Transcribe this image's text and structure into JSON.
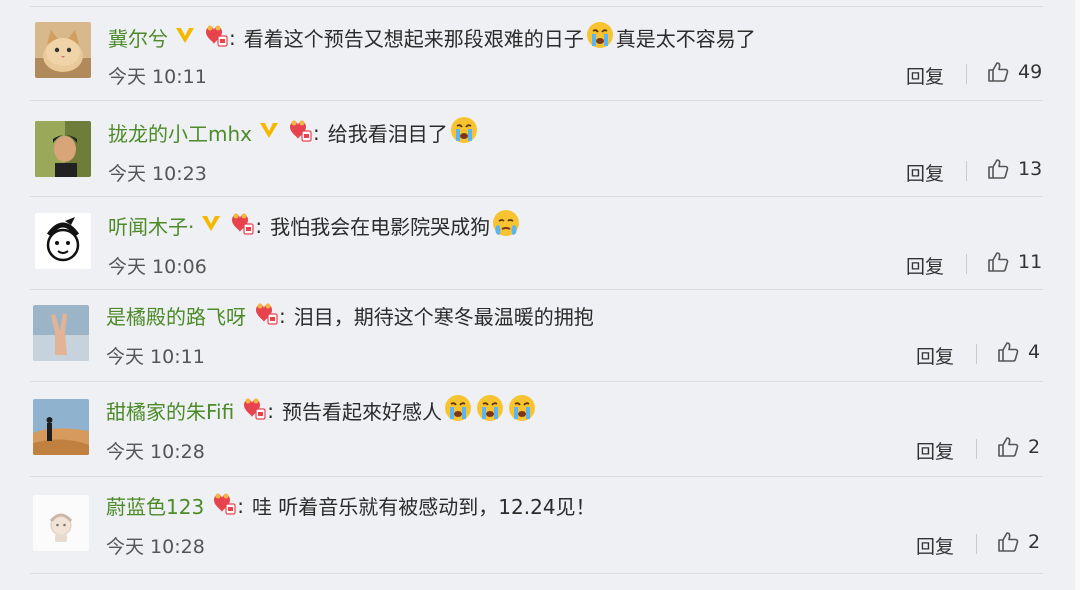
{
  "colors": {
    "username": "#4d8a28",
    "text": "#2b2b2b",
    "background": "#eef0f4"
  },
  "reply_label": "回复",
  "comments": [
    {
      "user": "冀尔兮",
      "verified": true,
      "text_before": "看着这个预告又想起来那段艰难的日子",
      "emojis_mid": [
        "crying-emoji"
      ],
      "text_after": "真是太不容易了",
      "time": "今天 10:11",
      "likes": "49",
      "avatar": "cat-photo-avatar"
    },
    {
      "user": "拢龙的小工mhx",
      "verified": true,
      "text_before": "给我看泪目了",
      "emojis_mid": [
        "crying-emoji"
      ],
      "text_after": "",
      "time": "今天 10:23",
      "likes": "13",
      "avatar": "person-photo-avatar"
    },
    {
      "user": "听闻木子·",
      "verified": true,
      "text_before": "我怕我会在电影院哭成狗",
      "emojis_mid": [
        "tears-emoji"
      ],
      "text_after": "",
      "time": "今天 10:06",
      "likes": "11",
      "avatar": "cartoon-avatar"
    },
    {
      "user": "是橘殿的路飞呀",
      "verified": false,
      "text_before": "泪目，期待这个寒冬最温暖的拥抱",
      "emojis_mid": [],
      "text_after": "",
      "time": "今天 10:11",
      "likes": "4",
      "avatar": "peace-hand-avatar"
    },
    {
      "user": "甜橘家的朱Fifi",
      "verified": false,
      "text_before": "预告看起來好感人",
      "emojis_mid": [
        "crying-emoji",
        "crying-emoji",
        "crying-emoji"
      ],
      "text_after": "",
      "time": "今天 10:28",
      "likes": "2",
      "avatar": "desert-avatar"
    },
    {
      "user": "蔚蓝色123",
      "verified": false,
      "text_before": "哇 听着音乐就有被感动到，12.24见！",
      "emojis_mid": [],
      "text_after": "",
      "time": "今天 10:28",
      "likes": "2",
      "avatar": "doll-avatar"
    }
  ]
}
